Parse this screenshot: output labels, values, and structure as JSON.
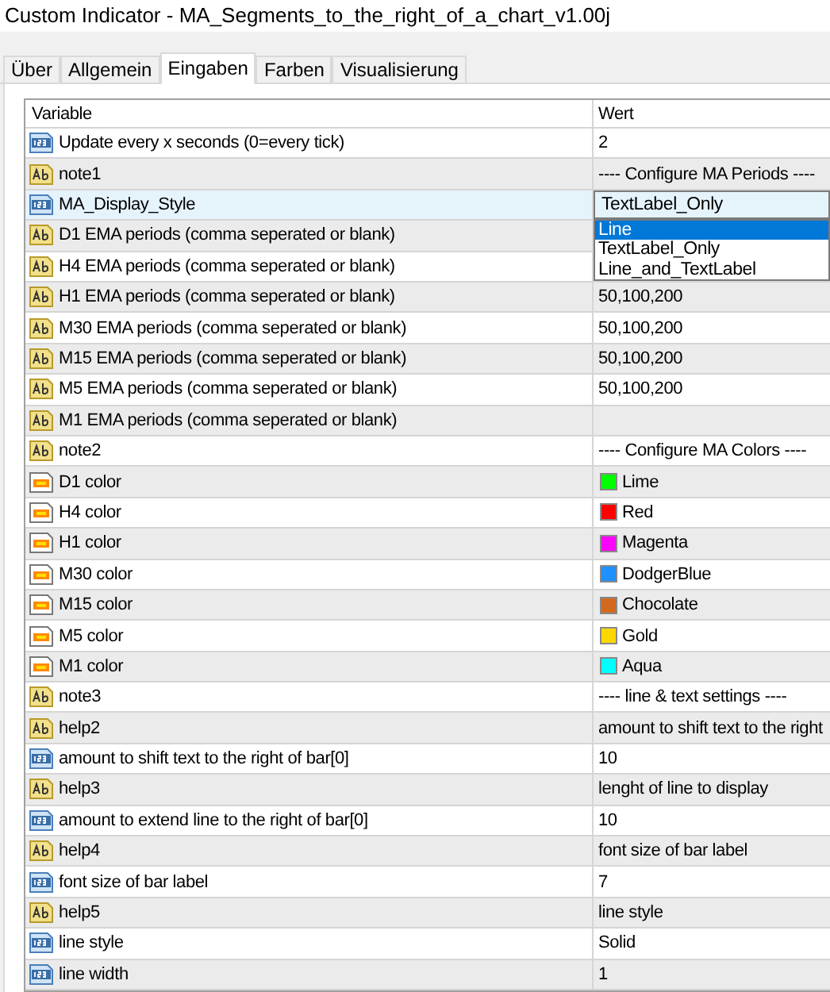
{
  "window": {
    "title": "Custom Indicator - MA_Segments_to_the_right_of_a_chart_v1.00j"
  },
  "tabs": [
    {
      "label": "Über",
      "selected": false
    },
    {
      "label": "Allgemein",
      "selected": false
    },
    {
      "label": "Eingaben",
      "selected": true
    },
    {
      "label": "Farben",
      "selected": false
    },
    {
      "label": "Visualisierung",
      "selected": false
    }
  ],
  "table": {
    "columns": [
      "Variable",
      "Wert"
    ],
    "rows": [
      {
        "kind": "number",
        "name": "Update every x seconds (0=every tick)",
        "value": "2",
        "selected": false
      },
      {
        "kind": "text",
        "name": "note1",
        "value": "---- Configure MA Periods ----",
        "selected": false
      },
      {
        "kind": "number",
        "name": "MA_Display_Style",
        "value": "TextLabel_Only",
        "selected": true,
        "dropdown": [
          {
            "label": "Line",
            "highlighted": true
          },
          {
            "label": "TextLabel_Only",
            "highlighted": false
          },
          {
            "label": "Line_and_TextLabel",
            "highlighted": false
          }
        ]
      },
      {
        "kind": "text",
        "name": "D1 EMA periods (comma seperated or blank)",
        "selected": false
      },
      {
        "kind": "text",
        "name": "H4 EMA periods (comma seperated or blank)",
        "selected": false
      },
      {
        "kind": "text",
        "name": "H1 EMA periods (comma seperated or blank)",
        "value": "50,100,200",
        "selected": false
      },
      {
        "kind": "text",
        "name": "M30 EMA periods (comma seperated or blank)",
        "value": "50,100,200",
        "selected": false
      },
      {
        "kind": "text",
        "name": "M15 EMA periods (comma seperated or blank)",
        "value": "50,100,200",
        "selected": false
      },
      {
        "kind": "text",
        "name": "M5 EMA periods (comma seperated or blank)",
        "value": "50,100,200",
        "selected": false
      },
      {
        "kind": "text",
        "name": "M1 EMA periods (comma seperated or blank)",
        "selected": false
      },
      {
        "kind": "text",
        "name": "note2",
        "value": "---- Configure MA Colors ----",
        "selected": false
      },
      {
        "kind": "color",
        "name": "D1 color",
        "value": "Lime",
        "color": "#00ff00",
        "selected": false
      },
      {
        "kind": "color",
        "name": "H4 color",
        "value": "Red",
        "color": "#ff0000",
        "selected": false
      },
      {
        "kind": "color",
        "name": "H1 color",
        "value": "Magenta",
        "color": "#ff00ff",
        "selected": false
      },
      {
        "kind": "color",
        "name": "M30 color",
        "value": "DodgerBlue",
        "color": "#1e90ff",
        "selected": false
      },
      {
        "kind": "color",
        "name": "M15 color",
        "value": "Chocolate",
        "color": "#d2691e",
        "selected": false
      },
      {
        "kind": "color",
        "name": "M5 color",
        "value": "Gold",
        "color": "#ffd700",
        "selected": false
      },
      {
        "kind": "color",
        "name": "M1 color",
        "value": "Aqua",
        "color": "#00ffff",
        "selected": false
      },
      {
        "kind": "text",
        "name": "note3",
        "value": "---- line & text settings ----",
        "selected": false
      },
      {
        "kind": "text",
        "name": "help2",
        "value": "amount to shift text to the right",
        "selected": false
      },
      {
        "kind": "number",
        "name": "amount to shift text to the right of bar[0]",
        "value": "10",
        "selected": false
      },
      {
        "kind": "text",
        "name": "help3",
        "value": "lenght of line to display",
        "selected": false
      },
      {
        "kind": "number",
        "name": "amount to extend line to the right of bar[0]",
        "value": "10",
        "selected": false
      },
      {
        "kind": "text",
        "name": "help4",
        "value": "font size of bar label",
        "selected": false
      },
      {
        "kind": "number",
        "name": "font size of bar label",
        "value": "7",
        "selected": false
      },
      {
        "kind": "text",
        "name": "help5",
        "value": "line style",
        "selected": false
      },
      {
        "kind": "number",
        "name": "line style",
        "value": "Solid",
        "selected": false
      },
      {
        "kind": "number",
        "name": "line width",
        "value": "1",
        "selected": false
      }
    ]
  }
}
